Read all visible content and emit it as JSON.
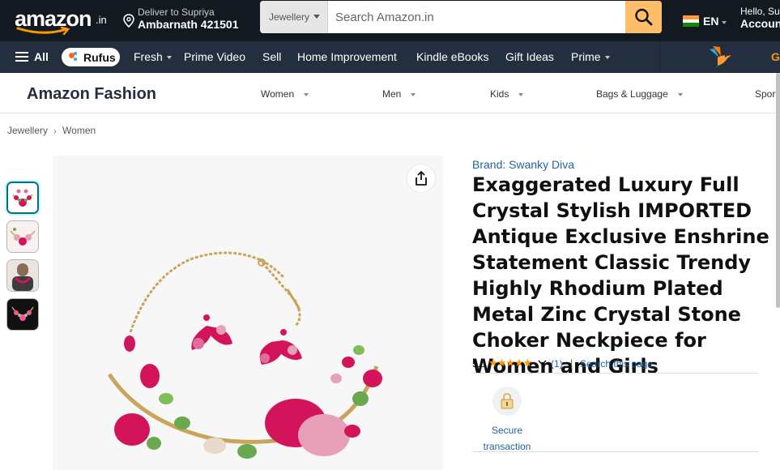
{
  "header": {
    "logo_text": "amazon",
    "logo_tld": ".in",
    "deliver_line1": "Deliver to Supriya",
    "deliver_line2": "Ambarnath 421501",
    "search_category": "Jewellery",
    "search_placeholder": "Search Amazon.in",
    "language": "EN",
    "account_line1": "Hello, Su",
    "account_line2": "Accoun"
  },
  "nav": {
    "all_label": "All",
    "rufus_label": "Rufus",
    "links": [
      "Fresh",
      "Prime Video",
      "Sell",
      "Home Improvement",
      "Kindle eBooks",
      "Gift Ideas",
      "Prime"
    ],
    "promo_text": "G"
  },
  "fashion": {
    "brand": "Amazon Fashion",
    "categories": [
      "Women",
      "Men",
      "Kids",
      "Bags & Luggage",
      "Sport"
    ]
  },
  "breadcrumb": [
    "Jewellery",
    "Women"
  ],
  "product": {
    "brand_link": "Brand: Swanky Diva",
    "title": "Exaggerated Luxury Full Crystal Stylish IMPORTED Antique Exclusive Enshrine Statement Classic Trendy Highly Rhodium Plated Metal Zinc Crystal Stone Choker Neckpiece for Women and Girls",
    "rating_value": "5.0",
    "rating_stars": 5,
    "rating_count": "(1)",
    "search_page_label": "Search this page",
    "secure_label": "Secure transaction"
  },
  "colors": {
    "nav_dark": "#131921",
    "nav_secondary": "#232f3e",
    "search_button": "#febd69",
    "link": "#2162a1",
    "star": "#ff9900",
    "gem_pink": "#d4145a"
  }
}
